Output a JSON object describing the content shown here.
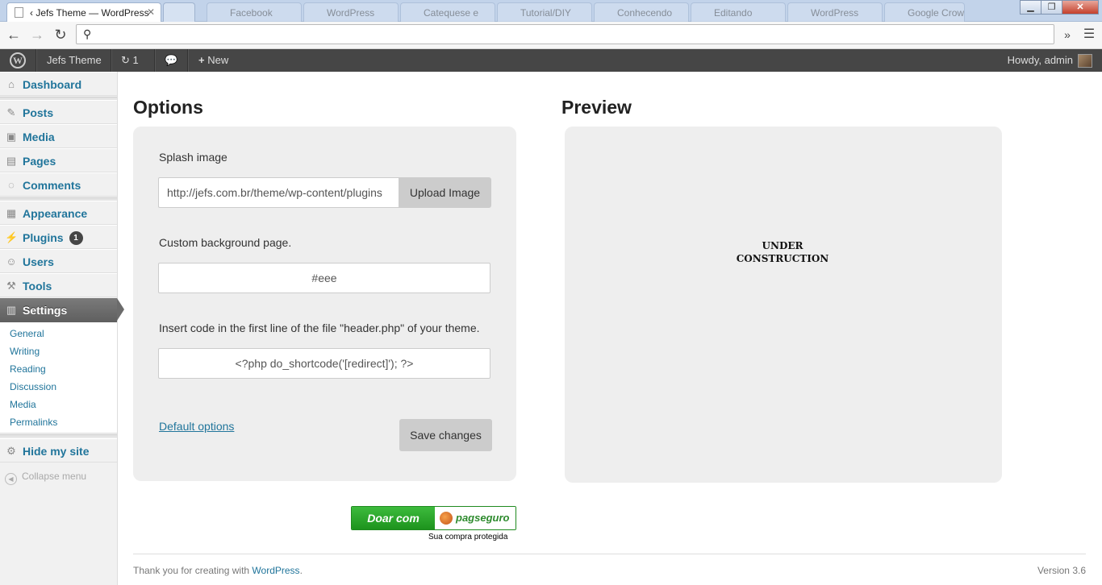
{
  "browser": {
    "active_tab_title": "‹ Jefs Theme — WordPress",
    "other_tabs": [
      "Facebook",
      "WordPress",
      "Catequese e",
      "Tutorial/DIY",
      "Conhecendo",
      "Editando",
      "WordPress",
      "Google Crow"
    ],
    "address": ""
  },
  "adminbar": {
    "site_name": "Jefs Theme",
    "updates_count": "1",
    "new_label": "New",
    "howdy": "Howdy, admin"
  },
  "sidebar": {
    "items": [
      {
        "label": "Dashboard",
        "icon": "dashboard-icon"
      },
      {
        "label": "Posts",
        "icon": "pin-icon"
      },
      {
        "label": "Media",
        "icon": "media-icon"
      },
      {
        "label": "Pages",
        "icon": "pages-icon"
      },
      {
        "label": "Comments",
        "icon": "comments-icon"
      },
      {
        "label": "Appearance",
        "icon": "appearance-icon"
      },
      {
        "label": "Plugins",
        "icon": "plug-icon",
        "badge": "1"
      },
      {
        "label": "Users",
        "icon": "users-icon"
      },
      {
        "label": "Tools",
        "icon": "tools-icon"
      },
      {
        "label": "Settings",
        "icon": "settings-icon"
      },
      {
        "label": "Hide my site",
        "icon": "gear-icon"
      }
    ],
    "settings_submenu": [
      "General",
      "Writing",
      "Reading",
      "Discussion",
      "Media",
      "Permalinks"
    ],
    "collapse_label": "Collapse menu"
  },
  "options": {
    "title": "Options",
    "splash_label": "Splash image",
    "splash_value": "http://jefs.com.br/theme/wp-content/plugins",
    "upload_button": "Upload Image",
    "bg_label": "Custom background page.",
    "bg_value": "#eee",
    "code_label": "Insert code in the first line of the file \"header.php\" of your theme.",
    "code_value": "<?php do_shortcode('[redirect]'); ?>",
    "default_link": "Default options",
    "save_button": "Save changes"
  },
  "preview": {
    "title": "Preview",
    "line1": "UNDER",
    "line2": "CONSTRUCTION"
  },
  "donate": {
    "left": "Doar com",
    "right": "pagseguro",
    "sub": "Sua compra protegida"
  },
  "footer": {
    "text": "Thank you for creating with",
    "link": "WordPress",
    "dot": ".",
    "version": "Version 3.6"
  },
  "colors": {
    "link": "#21759b",
    "adminbar": "#464646",
    "panel": "#eeeeee"
  }
}
